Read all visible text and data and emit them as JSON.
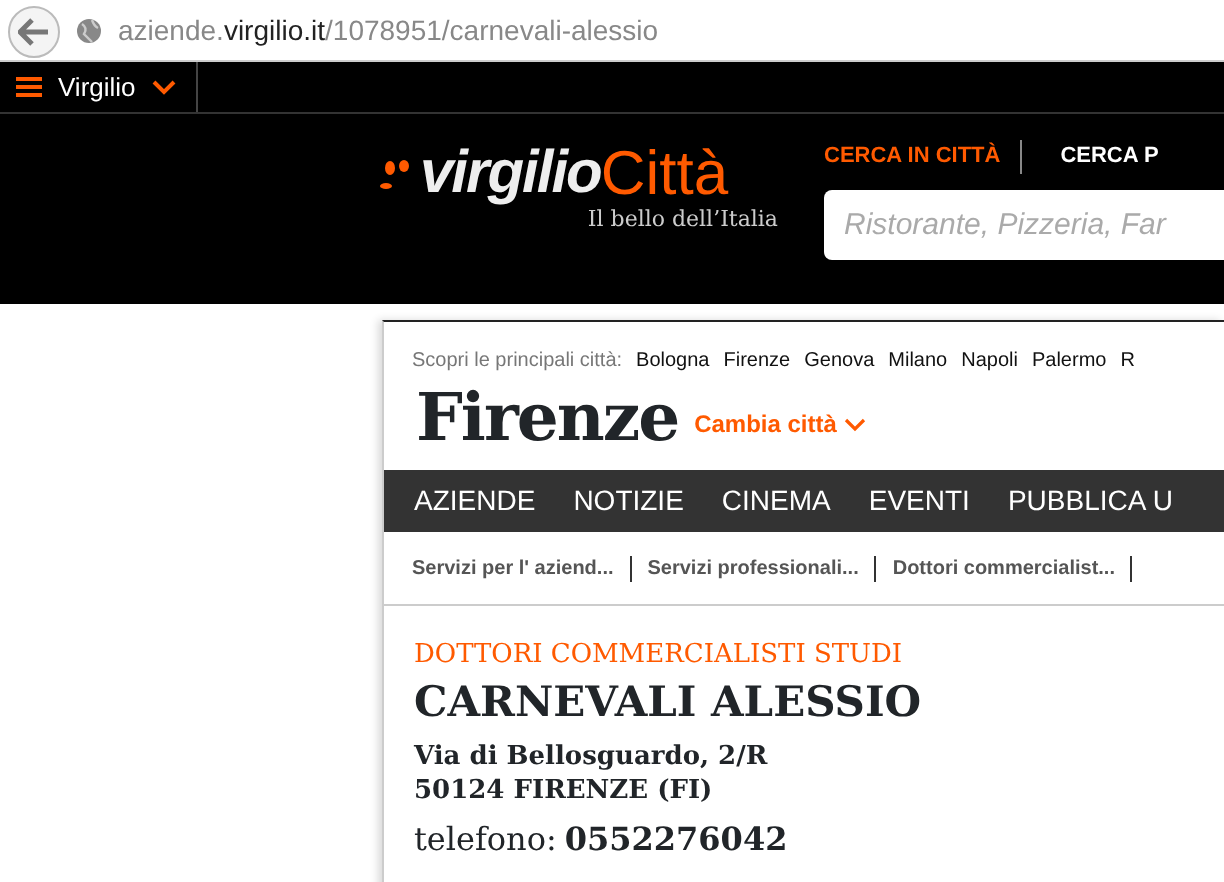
{
  "browser": {
    "url": {
      "subdomain": "aziende.",
      "domain": "virgilio.it",
      "path": "/1078951/carnevali-alessio"
    }
  },
  "top_bar": {
    "menu_label": "Virgilio"
  },
  "header": {
    "logo": {
      "word": "virgilio",
      "city": "Città",
      "tagline": "Il bello dell’Italia"
    },
    "search_tabs": [
      {
        "label": "CERCA IN CITTÀ",
        "selected": true
      },
      {
        "label": "CERCA P",
        "selected": false
      }
    ],
    "search": {
      "placeholder": "Ristorante, Pizzeria, Far"
    }
  },
  "city_bar": {
    "label": "Scopri le principali città:",
    "cities": [
      "Bologna",
      "Firenze",
      "Genova",
      "Milano",
      "Napoli",
      "Palermo",
      "R"
    ]
  },
  "city": {
    "name": "Firenze",
    "change_label": "Cambia città"
  },
  "nav": [
    "AZIENDE",
    "NOTIZIE",
    "CINEMA",
    "EVENTI",
    "PUBBLICA U"
  ],
  "breadcrumbs": [
    "Servizi per l' aziend...",
    "Servizi professionali...",
    "Dottori commercialist..."
  ],
  "business": {
    "category": "DOTTORI COMMERCIALISTI STUDI",
    "name": "CARNEVALI ALESSIO",
    "address_line_1": "Via di Bellosguardo, 2/R",
    "address_line_2": "50124 FIRENZE (FI)",
    "phone_label": "telefono:",
    "phone": "0552276042"
  }
}
